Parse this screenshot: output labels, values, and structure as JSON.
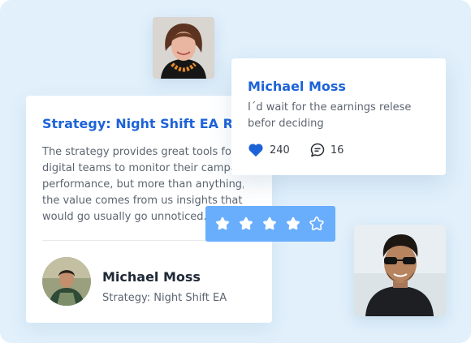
{
  "review": {
    "title": "Strategy: Night Shift EA Rev",
    "body": [
      "The strategy provides great tools for",
      "digital teams to monitor their campa",
      "performance, but more than anything,",
      "the value comes from us insights that",
      "would go usually go unnoticed."
    ],
    "author": {
      "name": "Michael Moss",
      "subtitle": "Strategy: Night Shift EA"
    }
  },
  "comment": {
    "author": "Michael Moss",
    "text": "I´d wait for the earnings relese befor deciding",
    "likes": "240",
    "replies": "16"
  },
  "rating": {
    "value": 4,
    "max": 5
  },
  "colors": {
    "accent": "#1d63d8",
    "rating_bar": "#69aefd",
    "background": "#e1f0fb"
  },
  "icons": {
    "like": "heart-icon",
    "comment": "chat-bubble-icon",
    "star": "star-icon"
  }
}
